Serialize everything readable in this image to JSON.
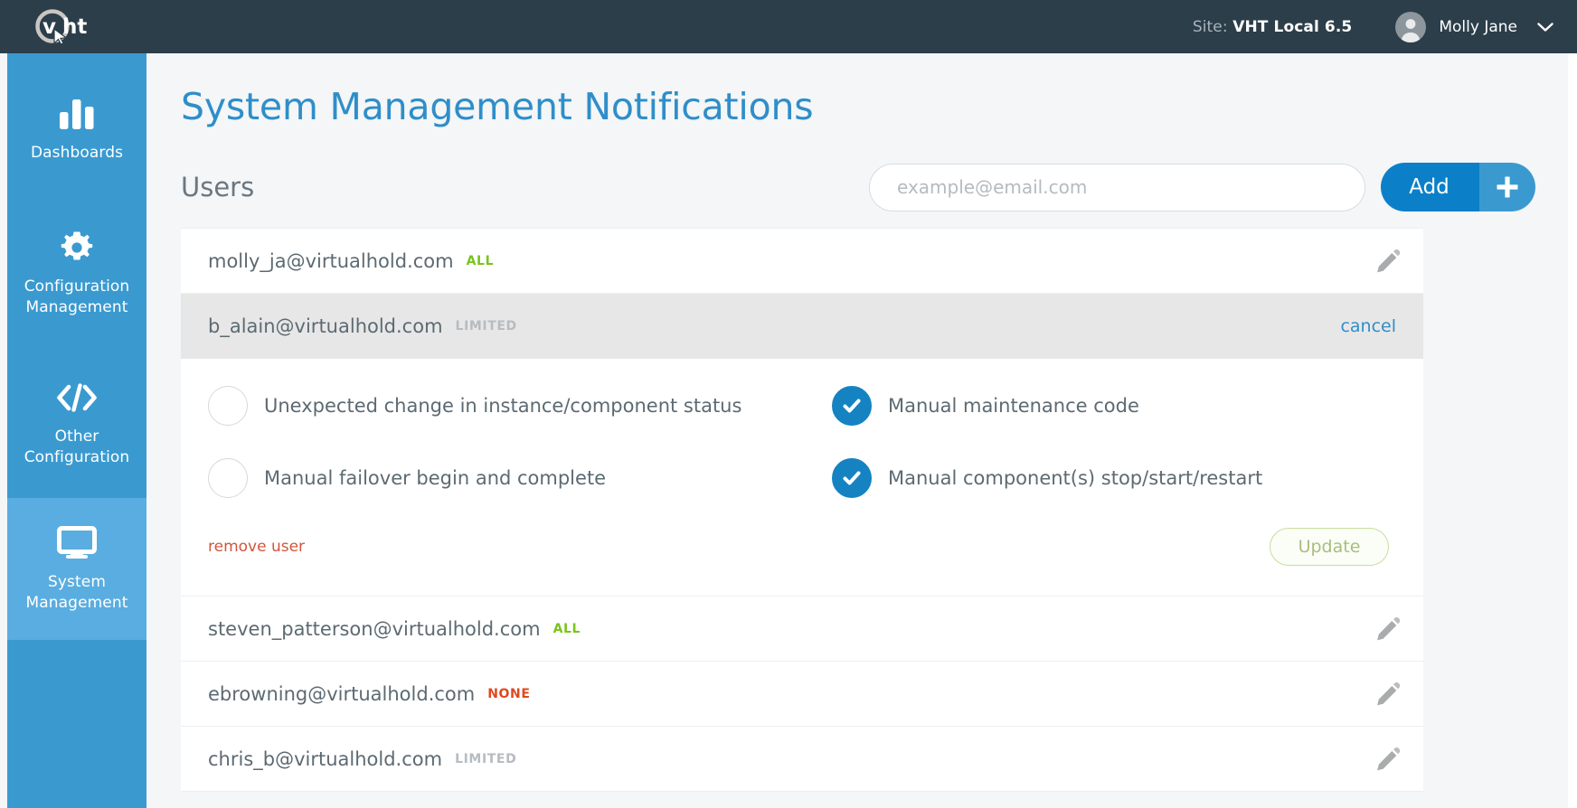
{
  "topbar": {
    "logo_alt": "vht-logo",
    "site_prefix": "Site:",
    "site_name": "VHT Local 6.5",
    "user_name": "Molly Jane",
    "caret_icon": "chevron-down-icon",
    "avatar_icon": "user-avatar-icon"
  },
  "sidebar": {
    "items": [
      {
        "label": "Dashboards",
        "icon": "bar-chart-icon",
        "active": false
      },
      {
        "label": "Configuration\nManagement",
        "line1": "Configuration",
        "line2": "Management",
        "icon": "gear-icon",
        "active": false
      },
      {
        "label": "Other\nConfiguration",
        "line1": "Other",
        "line2": "Configuration",
        "icon": "code-brackets-icon",
        "active": false
      },
      {
        "label": "System\nManagement",
        "line1": "System",
        "line2": "Management",
        "icon": "monitor-icon",
        "active": true
      }
    ]
  },
  "main": {
    "page_title": "System Management Notifications",
    "users_title": "Users",
    "email_input": {
      "value": "",
      "placeholder": "example@email.com"
    },
    "add_button": {
      "label": "Add",
      "plus_icon": "plus-icon"
    }
  },
  "users": [
    {
      "email": "molly_ja@virtualhold.com",
      "badge": "ALL",
      "badge_type": "all",
      "expanded": false,
      "action": "edit-pencil-icon"
    },
    {
      "email": "b_alain@virtualhold.com",
      "badge": "LIMITED",
      "badge_type": "limited",
      "expanded": true,
      "action_label": "cancel"
    },
    {
      "email": "steven_patterson@virtualhold.com",
      "badge": "ALL",
      "badge_type": "all",
      "expanded": false,
      "action": "edit-pencil-icon"
    },
    {
      "email": "ebrowning@virtualhold.com",
      "badge": "NONE",
      "badge_type": "none",
      "expanded": false,
      "action": "edit-pencil-icon"
    },
    {
      "email": "chris_b@virtualhold.com",
      "badge": "LIMITED",
      "badge_type": "limited",
      "expanded": false,
      "action": "edit-pencil-icon"
    }
  ],
  "expanded_panel": {
    "options": [
      {
        "label": "Unexpected change in instance/component status",
        "checked": false
      },
      {
        "label": "Manual maintenance code",
        "checked": true
      },
      {
        "label": "Manual failover begin and complete",
        "checked": false
      },
      {
        "label": "Manual component(s) stop/start/restart",
        "checked": true
      }
    ],
    "remove_user_label": "remove user",
    "update_label": "Update"
  },
  "colors": {
    "topbar_bg": "#2c3e4a",
    "sidebar_bg": "#3a9ad0",
    "sidebar_active_bg": "#5aade0",
    "accent_blue": "#2f8ec9",
    "add_button_blue": "#0b80c8",
    "checked_blue": "#1583c2",
    "badge_all_green": "#79c41d",
    "badge_none_red": "#e0491e",
    "badge_limited_gray": "#b6bcc1",
    "remove_user_red": "#d1553b",
    "update_green": "#a9bd7e",
    "page_bg": "#f4f6f7",
    "selected_row_bg": "#e7e7e7"
  }
}
